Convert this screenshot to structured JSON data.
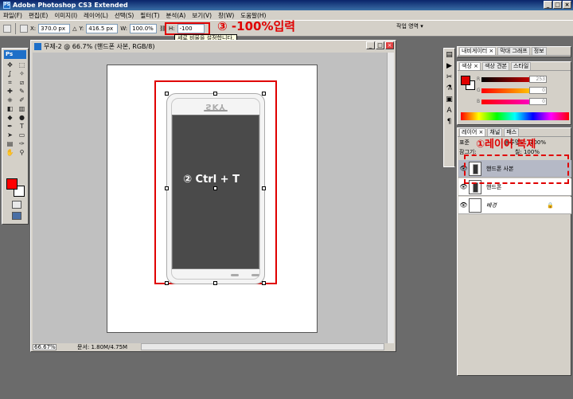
{
  "app": {
    "title": "Adobe Photoshop CS3 Extended",
    "icon": "PS"
  },
  "window_buttons": {
    "minimize": "_",
    "maximize": "□",
    "close": "×"
  },
  "menu": [
    "파일(F)",
    "편집(E)",
    "이미지(I)",
    "레이어(L)",
    "선택(S)",
    "필터(T)",
    "분석(A)",
    "보기(V)",
    "창(W)",
    "도움말(H)"
  ],
  "options": {
    "x_label": "X:",
    "x_value": "370.0 px",
    "y_label": "Y:",
    "y_value": "416.5 px",
    "w_label": "W:",
    "w_value": "100.0%",
    "h_label": "H:",
    "h_value": "-100",
    "workspace": "작업 영역 ▾",
    "tooltip": "세로 비율을 설정합니다."
  },
  "annotations": {
    "step1": "①레이어 복제",
    "step2": "② Ctrl + T",
    "step3": "③ -100%입력"
  },
  "toolbox": {
    "logo": "Ps",
    "tools": [
      "move-tool",
      "marquee-tool",
      "lasso-tool",
      "magic-wand-tool",
      "crop-tool",
      "slice-tool",
      "healing-tool",
      "brush-tool",
      "stamp-tool",
      "history-brush-tool",
      "eraser-tool",
      "gradient-tool",
      "blur-tool",
      "dodge-tool",
      "pen-tool",
      "type-tool",
      "path-select-tool",
      "shape-tool",
      "notes-tool",
      "eyedropper-tool",
      "hand-tool",
      "zoom-tool"
    ],
    "glyphs": [
      "✥",
      "⬚",
      "ʆ",
      "✧",
      "⌗",
      "⧄",
      "✚",
      "✎",
      "⎈",
      "✐",
      "◧",
      "▥",
      "◆",
      "●",
      "✒",
      "T",
      "➤",
      "▭",
      "▤",
      "✑",
      "✋",
      "⚲"
    ],
    "fg_color": "#ff0000",
    "bg_color": "#ffffff"
  },
  "document": {
    "title": "무제-2 @ 66.7% (핸드폰 사본, RGB/8)",
    "zoom": "66.67%",
    "docsize": "문서: 1.80M/4.75M",
    "phone_brand": "SKY"
  },
  "panels": {
    "navigator_tabs": [
      "내비게이터 ×",
      "막대 그래프",
      "정보"
    ],
    "color_tabs": [
      "색상 ×",
      "색상 견본",
      "스타일"
    ],
    "color_values": {
      "r": "253",
      "g": "0",
      "b": "0"
    },
    "color_labels": {
      "r": "R",
      "g": "G",
      "b": "B"
    },
    "layer_tabs": [
      "레이어 ×",
      "채널",
      "패스"
    ],
    "blend_mode": "표준",
    "opacity_label": "불투명도:",
    "opacity": "100%",
    "lock_label": "잠그기:",
    "fill_label": "칠:",
    "fill": "100%",
    "layers": [
      {
        "name": "핸드폰 사본",
        "selected": true
      },
      {
        "name": "핸드폰",
        "selected": false
      },
      {
        "name": "배경",
        "selected": false,
        "locked": true
      }
    ]
  },
  "colors": {
    "accent_red": "#e00000",
    "titlebar": "#0a246a",
    "chrome": "#d4d0c8"
  }
}
